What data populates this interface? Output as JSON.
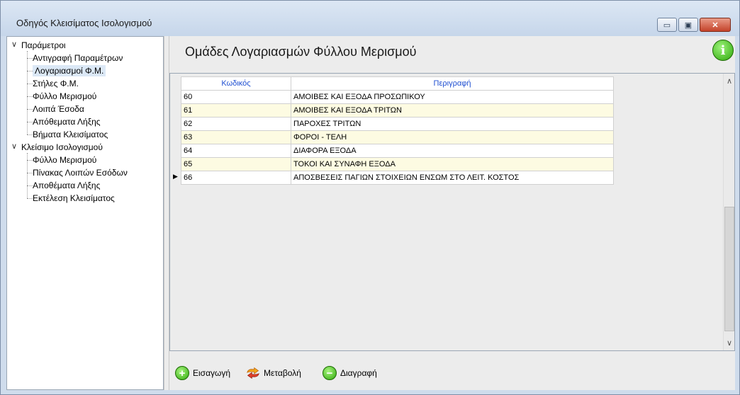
{
  "window": {
    "title": "Οδηγός Κλεισίματος Ισολογισμού"
  },
  "title_buttons": {
    "minimize": "▭",
    "maximize": "▣",
    "close": "✕"
  },
  "tree": {
    "groups": [
      {
        "label": "Παράμετροι",
        "expand": "∨",
        "items": [
          "Αντιγραφή Παραμέτρων",
          "Λογαριασμοί Φ.Μ.",
          "Στήλες Φ.Μ.",
          "Φύλλο Μερισμού",
          "Λοιπά Έσοδα",
          "Απόθεματα Λήξης",
          "Βήματα Κλεισίματος"
        ]
      },
      {
        "label": "Κλείσιμο Ισολογισμού",
        "expand": "∨",
        "items": [
          "Φύλλο Μερισμού",
          "Πίνακας Λοιπών Εσόδων",
          "Αποθέματα Λήξης",
          "Εκτέλεση Κλεισίματος"
        ]
      }
    ],
    "selected": "Λογαριασμοί Φ.Μ."
  },
  "page": {
    "title": "Ομάδες Λογαριασμών Φύλλου Μερισμού",
    "info_icon": "i"
  },
  "grid": {
    "columns": [
      "Κωδικός",
      "Περιγραφή"
    ],
    "rows": [
      {
        "code": "60",
        "desc": "ΑΜΟΙΒΕΣ ΚΑΙ ΕΞΟΔΑ ΠΡΟΣΩΠΙΚΟΥ"
      },
      {
        "code": "61",
        "desc": "ΑΜΟΙΒΕΣ ΚΑΙ ΕΞΟΔΑ ΤΡΙΤΩΝ"
      },
      {
        "code": "62",
        "desc": "ΠΑΡΟΧΕΣ ΤΡΙΤΩΝ"
      },
      {
        "code": "63",
        "desc": "ΦΟΡΟΙ - ΤΕΛΗ"
      },
      {
        "code": "64",
        "desc": "ΔΙΑΦΟΡΑ ΕΞΟΔΑ"
      },
      {
        "code": "65",
        "desc": "ΤΟΚΟΙ ΚΑΙ ΣΥΝΑΦΗ ΕΞΟΔΑ"
      },
      {
        "code": "66",
        "desc": "ΑΠΟΣΒΕΣΕΙΣ ΠΑΓΙΩΝ ΣΤΟΙΧΕΙΩΝ ΕΝΣΩΜ ΣΤΟ ΛΕΙΤ. ΚΟΣΤΟΣ"
      }
    ],
    "current_row_marker": "▶",
    "scroll_up": "∧",
    "scroll_down": "∨"
  },
  "toolbar": {
    "insert_label": "Εισαγωγή",
    "edit_label": "Μεταβολή",
    "delete_label": "Διαγραφή",
    "insert_icon": "+",
    "delete_icon": "−"
  },
  "colors": {
    "row_alt": "#fdfbe2",
    "header_text": "#1f4fd1",
    "accent_green": "#2ea80a"
  }
}
